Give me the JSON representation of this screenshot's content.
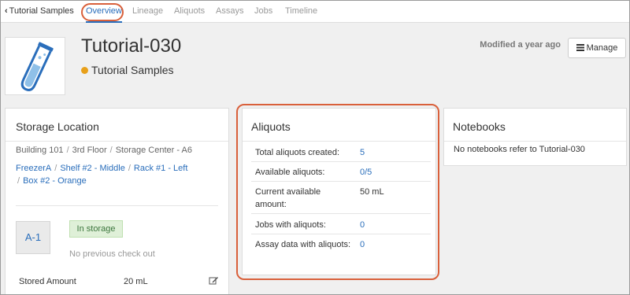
{
  "tabs": {
    "back_label": "Tutorial Samples",
    "items": [
      {
        "label": "Overview"
      },
      {
        "label": "Lineage"
      },
      {
        "label": "Aliquots"
      },
      {
        "label": "Assays"
      },
      {
        "label": "Jobs"
      },
      {
        "label": "Timeline"
      }
    ],
    "active": "Overview"
  },
  "header": {
    "title": "Tutorial-030",
    "sample_type": "Tutorial Samples",
    "status_dot_color": "#e8a01a",
    "modified": "Modified a year ago",
    "manage_label": "Manage"
  },
  "storage": {
    "title": "Storage Location",
    "path_plain": [
      "Building 101",
      "3rd Floor",
      "Storage Center - A6"
    ],
    "path_links": [
      "FreezerA",
      "Shelf #2 - Middle",
      "Rack #1 - Left",
      "Box #2 - Orange"
    ],
    "cell": "A-1",
    "status_badge": "In storage",
    "checkout_text": "No previous check out",
    "stored_amount_label": "Stored Amount",
    "stored_amount_value": "20 mL"
  },
  "aliquots": {
    "title": "Aliquots",
    "rows": [
      {
        "label": "Total aliquots created:",
        "value": "5"
      },
      {
        "label": "Available aliquots:",
        "value": "0/5"
      },
      {
        "label": "Current available amount:",
        "value": "50 mL"
      },
      {
        "label": "Jobs with aliquots:",
        "value": "0"
      },
      {
        "label": "Assay data with aliquots:",
        "value": "0"
      }
    ]
  },
  "notebooks": {
    "title": "Notebooks",
    "message": "No notebooks refer to Tutorial-030"
  },
  "colors": {
    "accent": "#2a6ebb",
    "highlight": "#d9603b",
    "success_bg": "#dff0d8"
  }
}
